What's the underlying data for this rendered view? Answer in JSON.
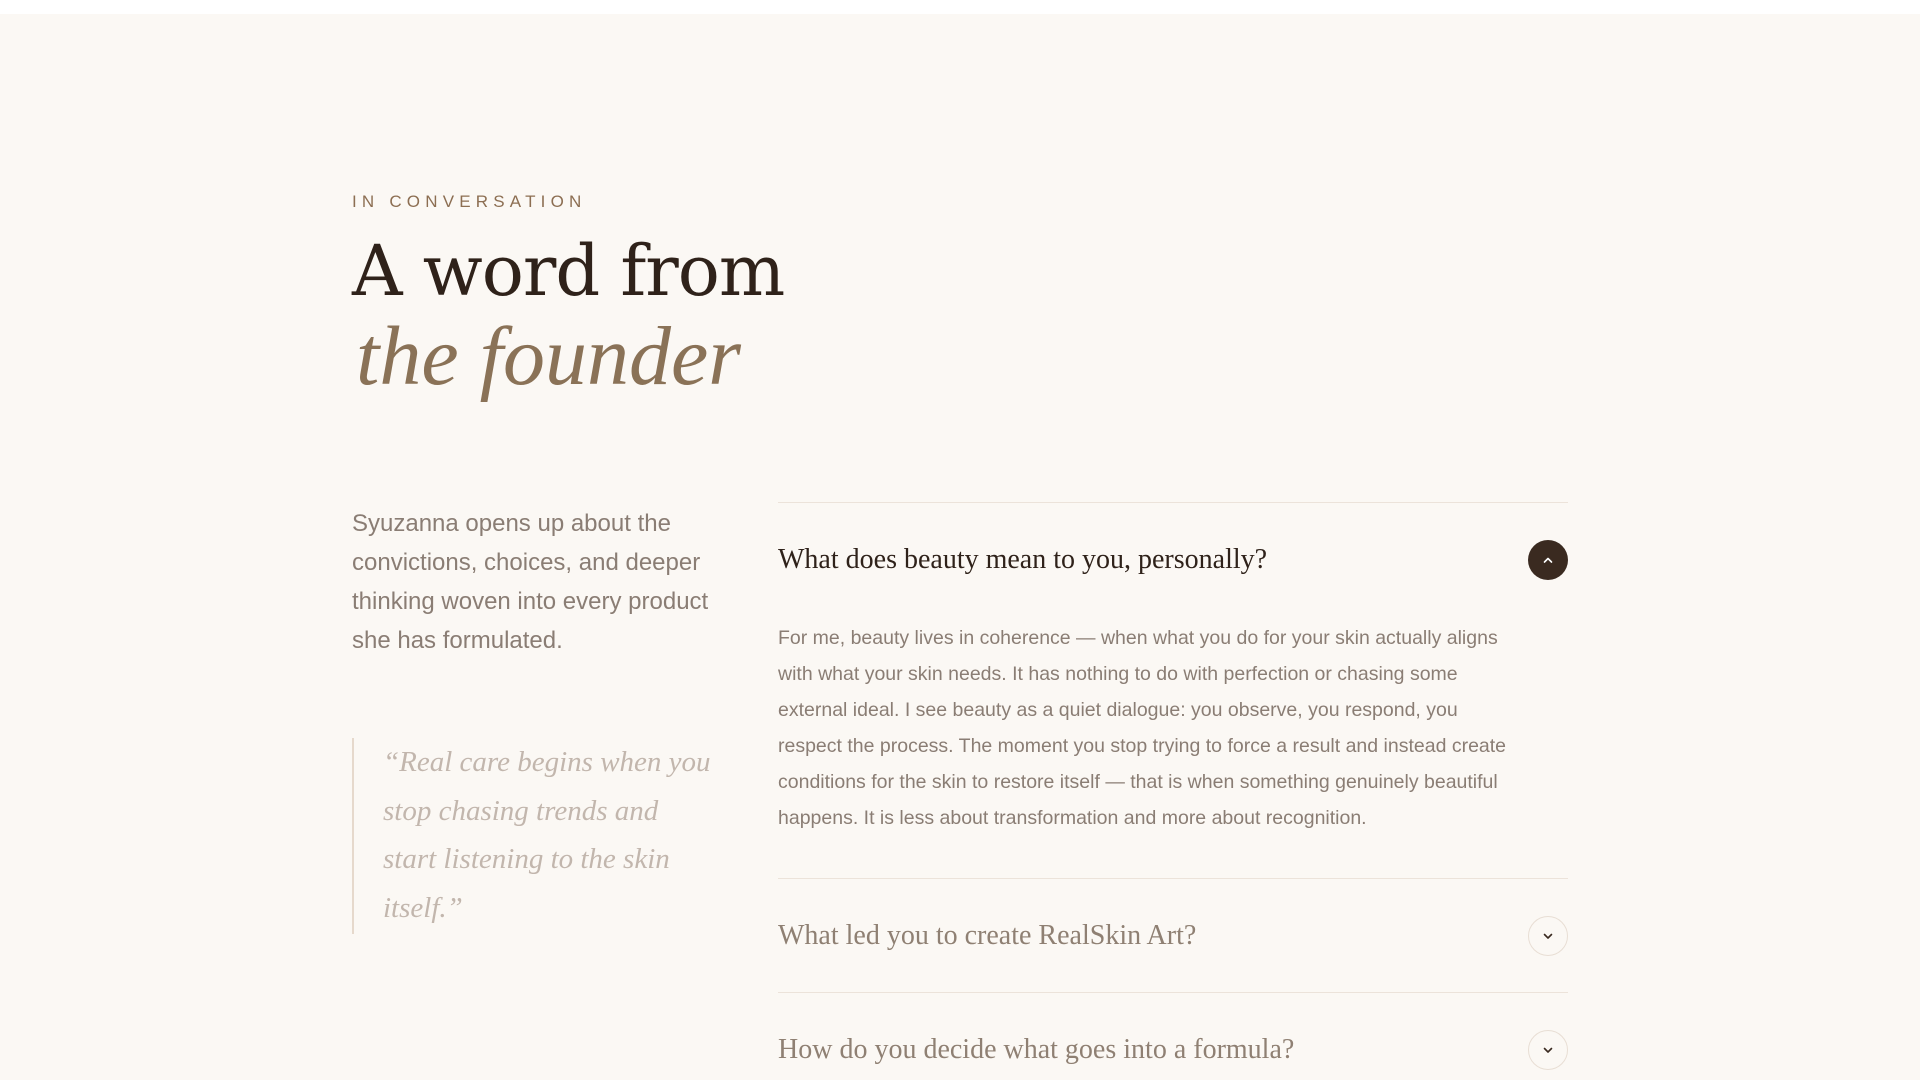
{
  "header": {
    "eyebrow": "IN CONVERSATION",
    "title_line1": "A word from",
    "title_line2": "the founder"
  },
  "intro": {
    "text": "Syuzanna opens up about the convictions, choices, and deeper thinking woven into every product she has formulated."
  },
  "quote": {
    "text": "“Real care begins when you stop chasing trends and start listening to the skin itself.”"
  },
  "faq": {
    "items": [
      {
        "question": "What does beauty mean to you, personally?",
        "answer": "For me, beauty lives in coherence — when what you do for your skin actually aligns with what your skin needs. It has nothing to do with perfection or chasing some external ideal. I see beauty as a quiet dialogue: you observe, you respond, you respect the process. The moment you stop trying to force a result and instead create conditions for the skin to restore itself — that is when something genuinely beautiful happens. It is less about transformation and more about recognition.",
        "expanded": true,
        "icon": "chevron-up-icon"
      },
      {
        "question": "What led you to create RealSkin Art?",
        "expanded": false,
        "icon": "chevron-down-icon"
      },
      {
        "question": "How do you decide what goes into a formula?",
        "expanded": false,
        "icon": "chevron-down-icon"
      }
    ]
  },
  "colors": {
    "background": "#fbf8f4",
    "heading": "#2f221a",
    "accent": "#8a7257",
    "eyebrow": "#8c6e52",
    "body_text": "#8a7d74",
    "quote_text": "#c2b6ad",
    "toggle_active": "#3a2a20"
  }
}
